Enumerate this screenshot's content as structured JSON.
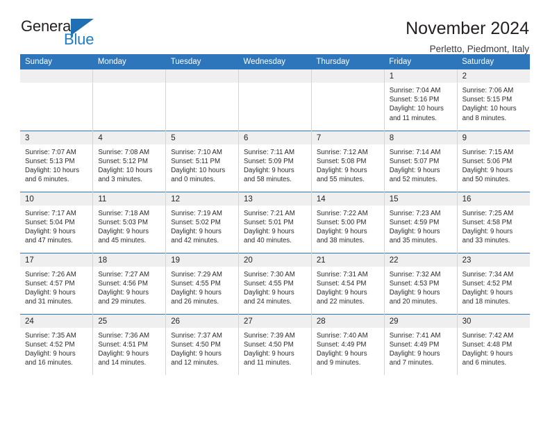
{
  "brand": {
    "name_part1": "General",
    "name_part2": "Blue",
    "flag_icon": "general-blue-flag-icon",
    "accent_color": "#1f6fb4"
  },
  "header": {
    "title": "November 2024",
    "subtitle": "Perletto, Piedmont, Italy"
  },
  "colors": {
    "header_row": "#2e76bc",
    "daynum_strip": "#efefef",
    "cell_divider": "#d4d4d4",
    "week_divider": "#2e76bc",
    "text": "#231f20"
  },
  "calendar": {
    "weekday_headers": [
      "Sunday",
      "Monday",
      "Tuesday",
      "Wednesday",
      "Thursday",
      "Friday",
      "Saturday"
    ],
    "weeks": [
      [
        {
          "day": "",
          "empty": true
        },
        {
          "day": "",
          "empty": true
        },
        {
          "day": "",
          "empty": true
        },
        {
          "day": "",
          "empty": true
        },
        {
          "day": "",
          "empty": true
        },
        {
          "day": "1",
          "sunrise": "Sunrise: 7:04 AM",
          "sunset": "Sunset: 5:16 PM",
          "daylight": "Daylight: 10 hours and 11 minutes."
        },
        {
          "day": "2",
          "sunrise": "Sunrise: 7:06 AM",
          "sunset": "Sunset: 5:15 PM",
          "daylight": "Daylight: 10 hours and 8 minutes."
        }
      ],
      [
        {
          "day": "3",
          "sunrise": "Sunrise: 7:07 AM",
          "sunset": "Sunset: 5:13 PM",
          "daylight": "Daylight: 10 hours and 6 minutes."
        },
        {
          "day": "4",
          "sunrise": "Sunrise: 7:08 AM",
          "sunset": "Sunset: 5:12 PM",
          "daylight": "Daylight: 10 hours and 3 minutes."
        },
        {
          "day": "5",
          "sunrise": "Sunrise: 7:10 AM",
          "sunset": "Sunset: 5:11 PM",
          "daylight": "Daylight: 10 hours and 0 minutes."
        },
        {
          "day": "6",
          "sunrise": "Sunrise: 7:11 AM",
          "sunset": "Sunset: 5:09 PM",
          "daylight": "Daylight: 9 hours and 58 minutes."
        },
        {
          "day": "7",
          "sunrise": "Sunrise: 7:12 AM",
          "sunset": "Sunset: 5:08 PM",
          "daylight": "Daylight: 9 hours and 55 minutes."
        },
        {
          "day": "8",
          "sunrise": "Sunrise: 7:14 AM",
          "sunset": "Sunset: 5:07 PM",
          "daylight": "Daylight: 9 hours and 52 minutes."
        },
        {
          "day": "9",
          "sunrise": "Sunrise: 7:15 AM",
          "sunset": "Sunset: 5:06 PM",
          "daylight": "Daylight: 9 hours and 50 minutes."
        }
      ],
      [
        {
          "day": "10",
          "sunrise": "Sunrise: 7:17 AM",
          "sunset": "Sunset: 5:04 PM",
          "daylight": "Daylight: 9 hours and 47 minutes."
        },
        {
          "day": "11",
          "sunrise": "Sunrise: 7:18 AM",
          "sunset": "Sunset: 5:03 PM",
          "daylight": "Daylight: 9 hours and 45 minutes."
        },
        {
          "day": "12",
          "sunrise": "Sunrise: 7:19 AM",
          "sunset": "Sunset: 5:02 PM",
          "daylight": "Daylight: 9 hours and 42 minutes."
        },
        {
          "day": "13",
          "sunrise": "Sunrise: 7:21 AM",
          "sunset": "Sunset: 5:01 PM",
          "daylight": "Daylight: 9 hours and 40 minutes."
        },
        {
          "day": "14",
          "sunrise": "Sunrise: 7:22 AM",
          "sunset": "Sunset: 5:00 PM",
          "daylight": "Daylight: 9 hours and 38 minutes."
        },
        {
          "day": "15",
          "sunrise": "Sunrise: 7:23 AM",
          "sunset": "Sunset: 4:59 PM",
          "daylight": "Daylight: 9 hours and 35 minutes."
        },
        {
          "day": "16",
          "sunrise": "Sunrise: 7:25 AM",
          "sunset": "Sunset: 4:58 PM",
          "daylight": "Daylight: 9 hours and 33 minutes."
        }
      ],
      [
        {
          "day": "17",
          "sunrise": "Sunrise: 7:26 AM",
          "sunset": "Sunset: 4:57 PM",
          "daylight": "Daylight: 9 hours and 31 minutes."
        },
        {
          "day": "18",
          "sunrise": "Sunrise: 7:27 AM",
          "sunset": "Sunset: 4:56 PM",
          "daylight": "Daylight: 9 hours and 29 minutes."
        },
        {
          "day": "19",
          "sunrise": "Sunrise: 7:29 AM",
          "sunset": "Sunset: 4:55 PM",
          "daylight": "Daylight: 9 hours and 26 minutes."
        },
        {
          "day": "20",
          "sunrise": "Sunrise: 7:30 AM",
          "sunset": "Sunset: 4:55 PM",
          "daylight": "Daylight: 9 hours and 24 minutes."
        },
        {
          "day": "21",
          "sunrise": "Sunrise: 7:31 AM",
          "sunset": "Sunset: 4:54 PM",
          "daylight": "Daylight: 9 hours and 22 minutes."
        },
        {
          "day": "22",
          "sunrise": "Sunrise: 7:32 AM",
          "sunset": "Sunset: 4:53 PM",
          "daylight": "Daylight: 9 hours and 20 minutes."
        },
        {
          "day": "23",
          "sunrise": "Sunrise: 7:34 AM",
          "sunset": "Sunset: 4:52 PM",
          "daylight": "Daylight: 9 hours and 18 minutes."
        }
      ],
      [
        {
          "day": "24",
          "sunrise": "Sunrise: 7:35 AM",
          "sunset": "Sunset: 4:52 PM",
          "daylight": "Daylight: 9 hours and 16 minutes."
        },
        {
          "day": "25",
          "sunrise": "Sunrise: 7:36 AM",
          "sunset": "Sunset: 4:51 PM",
          "daylight": "Daylight: 9 hours and 14 minutes."
        },
        {
          "day": "26",
          "sunrise": "Sunrise: 7:37 AM",
          "sunset": "Sunset: 4:50 PM",
          "daylight": "Daylight: 9 hours and 12 minutes."
        },
        {
          "day": "27",
          "sunrise": "Sunrise: 7:39 AM",
          "sunset": "Sunset: 4:50 PM",
          "daylight": "Daylight: 9 hours and 11 minutes."
        },
        {
          "day": "28",
          "sunrise": "Sunrise: 7:40 AM",
          "sunset": "Sunset: 4:49 PM",
          "daylight": "Daylight: 9 hours and 9 minutes."
        },
        {
          "day": "29",
          "sunrise": "Sunrise: 7:41 AM",
          "sunset": "Sunset: 4:49 PM",
          "daylight": "Daylight: 9 hours and 7 minutes."
        },
        {
          "day": "30",
          "sunrise": "Sunrise: 7:42 AM",
          "sunset": "Sunset: 4:48 PM",
          "daylight": "Daylight: 9 hours and 6 minutes."
        }
      ]
    ]
  }
}
